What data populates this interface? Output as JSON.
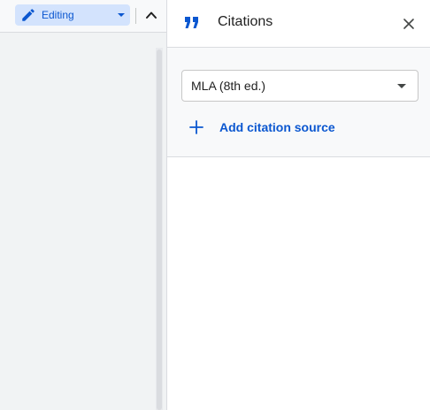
{
  "toolbar": {
    "mode_label": "Editing",
    "mode_icon": "pencil-icon",
    "collapse_icon": "chevron-up-icon"
  },
  "citations_panel": {
    "title": "Citations",
    "title_icon": "format-quote-icon",
    "close_icon": "close-icon",
    "style_select": {
      "value": "MLA (8th ed.)",
      "icon": "arrow-drop-down-icon"
    },
    "add_source_label": "Add citation source",
    "add_source_icon": "plus-icon"
  },
  "colors": {
    "accent": "#0b57d0",
    "mode_button_bg": "#d3e3fd",
    "panel_bg": "#ffffff",
    "controls_bg": "#f8f9fa",
    "divider": "#dadce0",
    "text": "#1f1f1f"
  }
}
